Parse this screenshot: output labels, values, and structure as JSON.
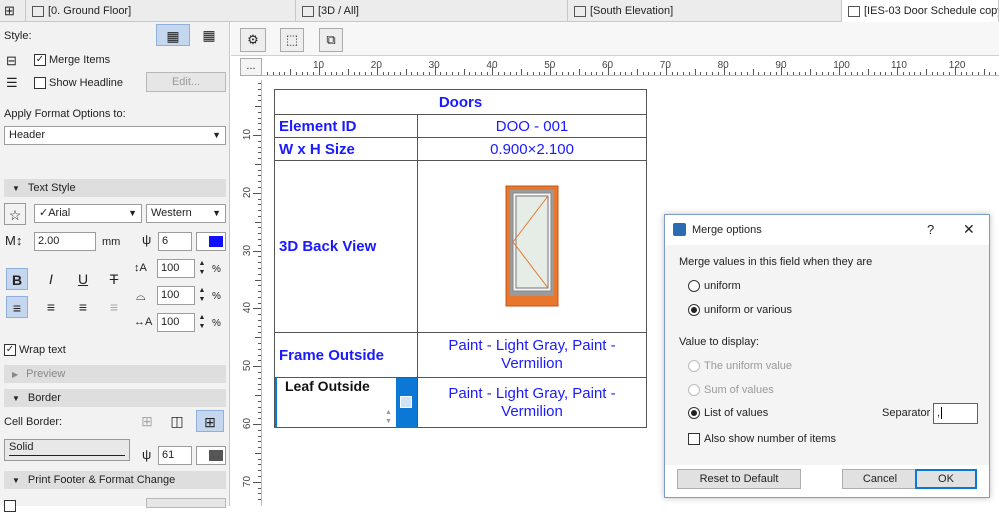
{
  "tabs": [
    {
      "label": "[0. Ground Floor]"
    },
    {
      "label": "[3D / All]"
    },
    {
      "label": "[South Elevation]"
    },
    {
      "label": "[IES-03 Door Schedule copy 1]"
    }
  ],
  "panel": {
    "style_label": "Style:",
    "merge_items_label": "Merge Items",
    "merge_items_checked": true,
    "show_headline_label": "Show Headline",
    "show_headline_checked": false,
    "edit_button": "Edit...",
    "apply_format_label": "Apply Format Options to:",
    "apply_format_value": "Header",
    "text_style_header": "Text Style",
    "font_value": "Arial",
    "font_check": "✓",
    "script_value": "Western",
    "size_value": "2.00",
    "size_unit": "mm",
    "pen_value": "6",
    "bold": "B",
    "italic": "I",
    "underline": "U",
    "strike": "T",
    "spacing1": "100",
    "spacing2": "100",
    "spacing3": "100",
    "percent": "%",
    "wrap_text_label": "Wrap text",
    "wrap_text_checked": true,
    "preview_header": "Preview",
    "border_header": "Border",
    "cell_border_label": "Cell Border:",
    "line_type_value": "Solid",
    "border_pen_value": "61",
    "print_footer_header": "Print Footer & Format Change"
  },
  "ruler": {
    "h_ticks": [
      "10",
      "20",
      "30",
      "40",
      "50",
      "60",
      "70",
      "80",
      "90",
      "100",
      "110",
      "120"
    ],
    "v_ticks": [
      "10",
      "20",
      "30",
      "40",
      "50",
      "60",
      "70"
    ],
    "more_button": "..."
  },
  "schedule": {
    "title": "Doors",
    "rows": [
      {
        "label": "Element ID",
        "value": "DOO - 001"
      },
      {
        "label": "W x H Size",
        "value": "0.900×2.100"
      },
      {
        "label": "3D Back View",
        "value": ""
      },
      {
        "label": "Frame Outside",
        "value": "Paint - Light Gray, Paint - Vermilion"
      },
      {
        "label": "Leaf Outside",
        "value": "Paint - Light Gray, Paint - Vermilion"
      }
    ]
  },
  "dialog": {
    "title": "Merge options",
    "help": "?",
    "close": "✕",
    "merge_prompt": "Merge values in this field when they are",
    "opt_uniform": "uniform",
    "opt_uniform_various": "uniform or various",
    "value_display_label": "Value to display:",
    "opt_uniform_value": "The uniform value",
    "opt_sum": "Sum of values",
    "opt_list": "List of values",
    "separator_label": "Separator",
    "separator_value": ",",
    "also_show_label": "Also show number of items",
    "reset_button": "Reset to Default",
    "cancel_button": "Cancel",
    "ok_button": "OK"
  },
  "colors": {
    "accent": "#1a1aff",
    "selection": "#0a78d4",
    "door_frame": "#e8762c"
  }
}
